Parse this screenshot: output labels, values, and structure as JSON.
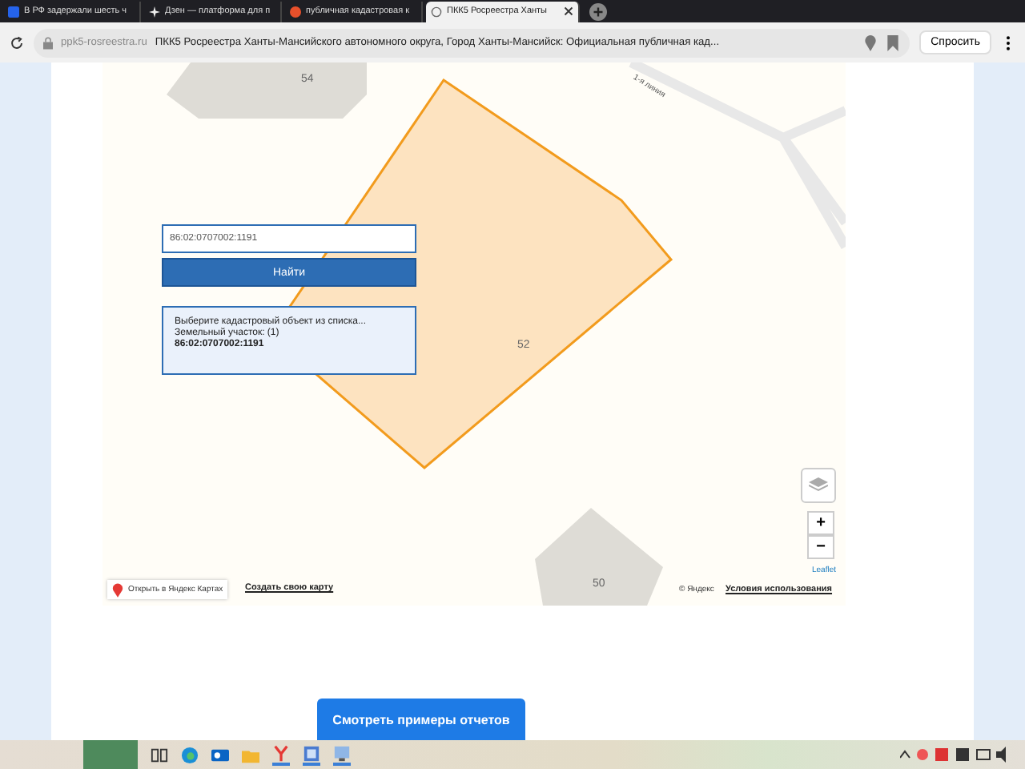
{
  "tabs": [
    {
      "label": "В РФ задержали шесть ч",
      "selected": false
    },
    {
      "label": "Дзен — платформа для п",
      "selected": false
    },
    {
      "label": "публичная кадастровая к",
      "selected": false
    },
    {
      "label": "ПКК5 Росреестра Ханты",
      "selected": true
    }
  ],
  "address_bar": {
    "domain": "ppk5-rosreestra.ru",
    "title": "ПКК5 Росреестра Ханты-Мансийского автономного округа, Город Ханты-Мансийск: Официальная публичная кад...",
    "ask_button": "Спросить"
  },
  "map": {
    "search": {
      "value": "86:02:0707002:1191"
    },
    "find_button": "Найти",
    "result": {
      "hint": "Выберите кадастровый объект из списка...",
      "category": "Земельный участок: (1)",
      "number": "86:02:0707002:1191"
    },
    "parcel_labels": [
      "54",
      "52",
      "50"
    ],
    "street_label": "1-я линия",
    "zoom_in": "+",
    "zoom_out": "−",
    "attribution": "Leaflet",
    "open_in_yandex": "Открыть в Яндекс Картах",
    "create_map_link": "Создать свою карту",
    "copyright": "© Яндекс",
    "terms_link": "Условия использования"
  },
  "cta_button": "Смотреть примеры отчетов"
}
